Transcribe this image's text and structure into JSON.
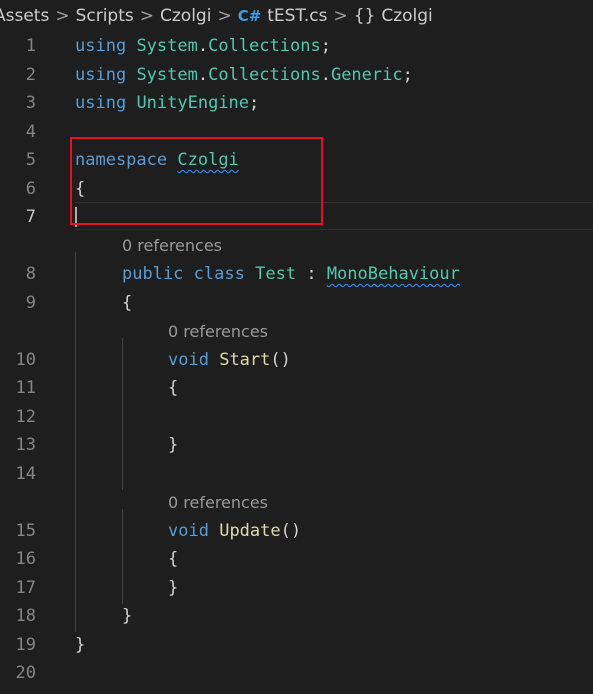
{
  "breadcrumb": {
    "items": [
      "Assets",
      "Scripts",
      "Czolgi",
      "tEST.cs",
      "Czolgi"
    ],
    "separator": ">",
    "file_icon": "C#",
    "namespace_icon": "{}"
  },
  "editor": {
    "line_numbers": [
      "1",
      "2",
      "3",
      "4",
      "5",
      "6",
      "7",
      "8",
      "9",
      "10",
      "11",
      "12",
      "13",
      "14",
      "15",
      "16",
      "17",
      "18",
      "19",
      "20"
    ],
    "current_line": "7",
    "codelens": [
      "0 references",
      "0 references",
      "0 references"
    ],
    "lines": {
      "l1": [
        "using",
        "System",
        ".",
        "Collections",
        ";"
      ],
      "l2": [
        "using",
        "System",
        ".",
        "Collections",
        ".",
        "Generic",
        ";"
      ],
      "l3": [
        "using",
        "UnityEngine",
        ";"
      ],
      "l5": [
        "namespace",
        "Czolgi"
      ],
      "l6": [
        "{"
      ],
      "l8": [
        "public",
        "class",
        "Test",
        ":",
        "MonoBehaviour"
      ],
      "l9": [
        "{"
      ],
      "l10": [
        "void",
        "Start",
        "()"
      ],
      "l11": [
        "{"
      ],
      "l13": [
        "}"
      ],
      "l15": [
        "void",
        "Update",
        "()"
      ],
      "l16": [
        "{"
      ],
      "l17": [
        "}"
      ],
      "l18": [
        "}"
      ],
      "l19": [
        "}"
      ]
    }
  },
  "colors": {
    "background": "#1e1e1e",
    "keyword": "#569cd6",
    "type": "#4ec9b0",
    "function": "#dcdcaa",
    "plain": "#d4d4d4",
    "line_number": "#858585",
    "codelens": "#999999",
    "highlight_box": "#e81123"
  }
}
